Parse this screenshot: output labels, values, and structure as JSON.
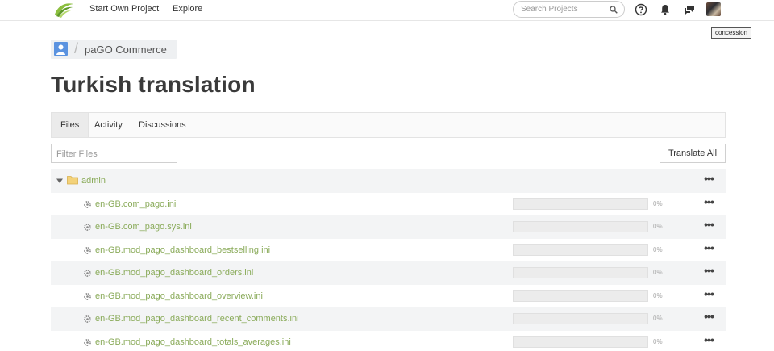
{
  "nav": {
    "start_project": "Start Own Project",
    "explore": "Explore",
    "search_placeholder": "Search Projects",
    "tooltip": "concession"
  },
  "breadcrumb": {
    "project": "paGO Commerce"
  },
  "page": {
    "title": "Turkish translation"
  },
  "tabs": {
    "files": "Files",
    "activity": "Activity",
    "discussions": "Discussions"
  },
  "toolbar": {
    "filter_placeholder": "Filter Files",
    "translate_all": "Translate All"
  },
  "folder": {
    "name": "admin"
  },
  "files": [
    {
      "name": "en-GB.com_pago.ini",
      "progress": 0,
      "percent": "0%"
    },
    {
      "name": "en-GB.com_pago.sys.ini",
      "progress": 0,
      "percent": "0%"
    },
    {
      "name": "en-GB.mod_pago_dashboard_bestselling.ini",
      "progress": 0,
      "percent": "0%"
    },
    {
      "name": "en-GB.mod_pago_dashboard_orders.ini",
      "progress": 0,
      "percent": "0%"
    },
    {
      "name": "en-GB.mod_pago_dashboard_overview.ini",
      "progress": 0,
      "percent": "0%"
    },
    {
      "name": "en-GB.mod_pago_dashboard_recent_comments.ini",
      "progress": 0,
      "percent": "0%"
    },
    {
      "name": "en-GB.mod_pago_dashboard_totals_averages.ini",
      "progress": 0,
      "percent": "0%"
    }
  ],
  "colors": {
    "accent_green": "#8aab5a",
    "row_shade": "#f3f4f5"
  },
  "icons": {
    "logo": "leaf-logo-icon",
    "search": "search-icon",
    "help": "help-icon",
    "notifications": "bell-icon",
    "messages": "chat-icon",
    "folder": "folder-icon",
    "file": "file-gear-icon",
    "more": "more-dots-icon"
  }
}
